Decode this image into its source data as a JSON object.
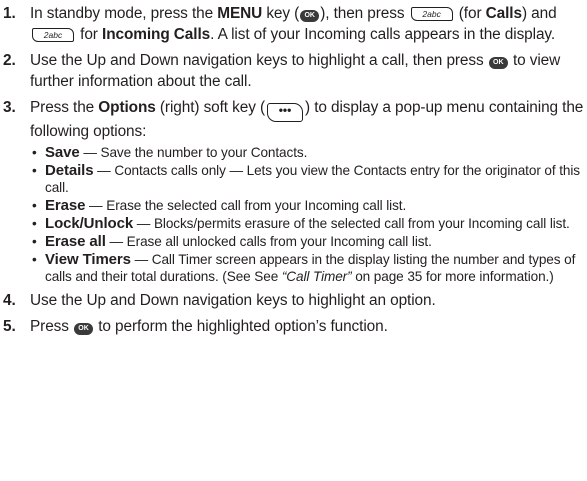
{
  "steps": [
    {
      "num": "1.",
      "t1": "In standby mode, press the ",
      "b1": "MENU",
      "t2": " key (",
      "ok_label": "OK",
      "t3": "), then press ",
      "key2_label": "2abc",
      "t4": " (for ",
      "b2": "Calls",
      "t5": ") and ",
      "t6": " for ",
      "b3": "Incoming Calls",
      "t7": ". A list of your Incoming calls appears in the display."
    },
    {
      "num": "2.",
      "t1": "Use the Up and Down navigation keys to highlight a call, then press ",
      "ok_label": "OK",
      "t2": " to view further information about the call."
    },
    {
      "num": "3.",
      "t1": "Press the ",
      "b1": "Options",
      "t2": " (right) soft key (",
      "softkey_label": "•••",
      "t3": ") to display a pop-up menu containing the following options:",
      "options": [
        {
          "term": "Save",
          "desc": " — Save the number to your Contacts."
        },
        {
          "term": "Details",
          "desc": " — Contacts calls only — Lets you view the Contacts entry for the originator of this call."
        },
        {
          "term": "Erase",
          "desc": " — Erase the selected call from your Incoming call list."
        },
        {
          "term": "Lock/Unlock",
          "desc": " — Blocks/permits erasure of the selected call from your Incoming call list."
        },
        {
          "term": "Erase all",
          "desc": " — Erase all unlocked calls from your Incoming call list."
        },
        {
          "term": "View Timers",
          "desc": " — Call Timer screen appears in the display listing the number and types of calls and their total durations. (See See ",
          "ref": "“Call Timer”",
          "desc2": " on page 35 for more information.)"
        }
      ]
    },
    {
      "num": "4.",
      "t1": "Use the Up and Down navigation keys to highlight an option."
    },
    {
      "num": "5.",
      "t1": "Press ",
      "ok_label": "OK",
      "t2": " to perform the highlighted option’s function."
    }
  ]
}
